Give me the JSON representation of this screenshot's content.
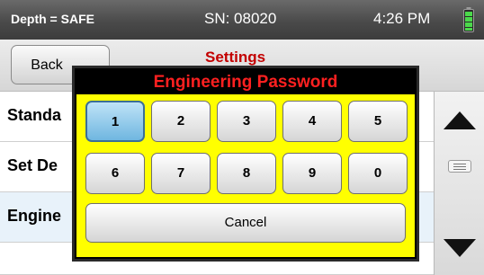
{
  "status_bar": {
    "depth_label": "Depth = SAFE",
    "serial": "SN: 08020",
    "time": "4:26 PM",
    "battery_icon": "battery-icon",
    "battery_color": "#4bd84b"
  },
  "header": {
    "back_label": "Back",
    "title": "Settings",
    "title_color": "#c30000"
  },
  "list": {
    "items": [
      {
        "label": "Standa"
      },
      {
        "label": "Set De"
      },
      {
        "label": "Engine"
      }
    ]
  },
  "scroll": {
    "up_icon": "triangle-up-icon",
    "down_icon": "triangle-down-icon",
    "thumb_icon": "grip-icon"
  },
  "dialog": {
    "title": "Engineering Password",
    "title_color": "#ff2020",
    "background": "#ffff00",
    "keys": [
      "1",
      "2",
      "3",
      "4",
      "5",
      "6",
      "7",
      "8",
      "9",
      "0"
    ],
    "active_key": "1",
    "cancel_label": "Cancel"
  }
}
